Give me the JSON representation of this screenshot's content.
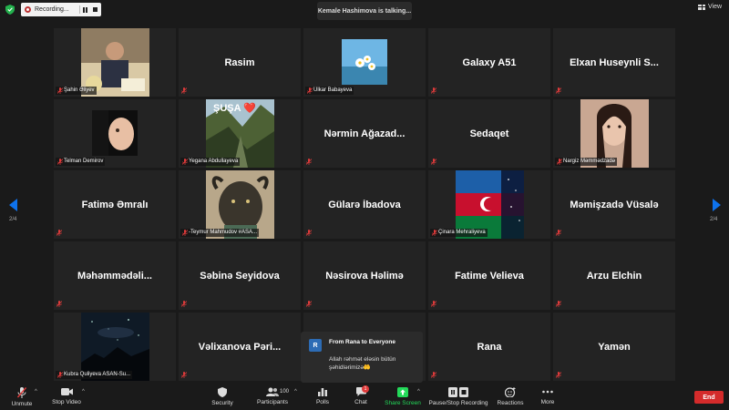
{
  "topbar": {
    "recording_label": "Recording...",
    "talking": "Kemale Hashimova is talking...",
    "view_label": "View"
  },
  "tiles": [
    {
      "name": "Şahin Əliyev",
      "type": "photo"
    },
    {
      "name": "Rasim",
      "type": "text"
    },
    {
      "name": "Ülkar Babayeva",
      "type": "photo"
    },
    {
      "name": "Galaxy A51",
      "type": "text"
    },
    {
      "name": "Elxan Huseynli S...",
      "type": "text"
    },
    {
      "name": "Telman Demirov",
      "type": "photo"
    },
    {
      "name": "Yegana Abdullayeva",
      "type": "photo",
      "overlay": "ŞUŞA ❤️"
    },
    {
      "name": "Nərmin Ağazad...",
      "type": "text"
    },
    {
      "name": "Sedaqet",
      "type": "text"
    },
    {
      "name": "Nargiz Məmmədzadə",
      "type": "photo"
    },
    {
      "name": "Fatimə Əmralı",
      "type": "text"
    },
    {
      "name": "-Teymur Mahmudov #ASA...",
      "type": "photo"
    },
    {
      "name": "Gülarə İbadova",
      "type": "text"
    },
    {
      "name": "Çinara Mehraliyeva",
      "type": "photo"
    },
    {
      "name": "Məmişzadə Vüsalə",
      "type": "text"
    },
    {
      "name": "Məhəmmədəli...",
      "type": "text"
    },
    {
      "name": "Səbinə Seyidova",
      "type": "text"
    },
    {
      "name": "Nəsirova Həlimə",
      "type": "text"
    },
    {
      "name": "Fatime Velieva",
      "type": "text"
    },
    {
      "name": "Arzu Elchin",
      "type": "text"
    },
    {
      "name": "Kubra Quliyeva ASAN-Su...",
      "type": "photo"
    },
    {
      "name": "Vəlixanova Pəri...",
      "type": "text"
    },
    {
      "name": "",
      "type": "empty"
    },
    {
      "name": "Rana",
      "type": "text"
    },
    {
      "name": "Yamən",
      "type": "text"
    }
  ],
  "pager": {
    "left": "2/4",
    "right": "2/4"
  },
  "chat_popup": {
    "avatar": "R",
    "from": "From Rana to Everyone",
    "message": "Allah rəhmət eləsin bütün şəhidlərimizə🤲"
  },
  "toolbar": {
    "unmute": "Unmute",
    "stop_video": "Stop Video",
    "security": "Security",
    "participants": "Participants",
    "participants_count": "100",
    "polls": "Polls",
    "chat": "Chat",
    "chat_badge": "1",
    "share_screen": "Share Screen",
    "recording": "Pause/Stop Recording",
    "reactions": "Reactions",
    "more": "More",
    "end": "End"
  },
  "colors": {
    "accent_blue": "#0e72ed",
    "share_green": "#23d959",
    "end_red": "#d42b2b",
    "muted_red": "#e03b3b"
  }
}
